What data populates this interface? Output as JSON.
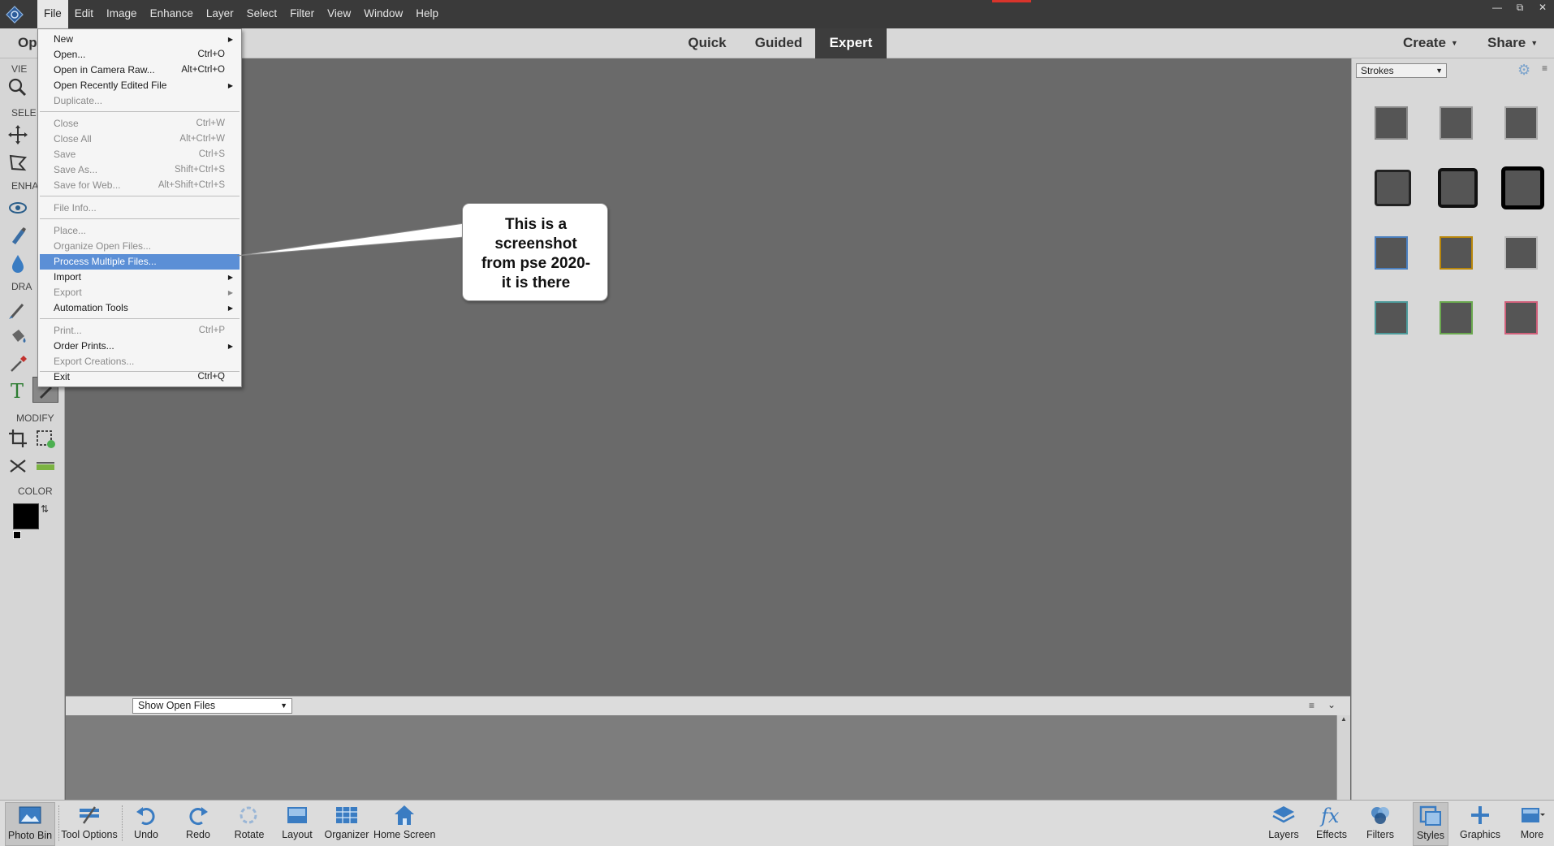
{
  "menubar": {
    "items": [
      "File",
      "Edit",
      "Image",
      "Enhance",
      "Layer",
      "Select",
      "Filter",
      "View",
      "Window",
      "Help"
    ],
    "active": "File"
  },
  "modebar": {
    "open_label": "Op",
    "tabs": [
      "Quick",
      "Guided",
      "Expert"
    ],
    "active_tab": "Expert",
    "create_label": "Create",
    "share_label": "Share"
  },
  "toolbox": {
    "sections": [
      "VIE",
      "SELE",
      "ENHA",
      "DRA"
    ],
    "modify_label": "MODIFY",
    "color_label": "COLOR"
  },
  "file_menu": {
    "items": [
      {
        "label": "New",
        "shortcut": "",
        "submenu": true,
        "enabled": true
      },
      {
        "label": "Open...",
        "shortcut": "Ctrl+O",
        "submenu": false,
        "enabled": true
      },
      {
        "label": "Open in Camera Raw...",
        "shortcut": "Alt+Ctrl+O",
        "submenu": false,
        "enabled": true
      },
      {
        "label": "Open Recently Edited File",
        "shortcut": "",
        "submenu": true,
        "enabled": true
      },
      {
        "label": "Duplicate...",
        "shortcut": "",
        "submenu": false,
        "enabled": false
      },
      {
        "label": "Close",
        "shortcut": "Ctrl+W",
        "submenu": false,
        "enabled": false
      },
      {
        "label": "Close All",
        "shortcut": "Alt+Ctrl+W",
        "submenu": false,
        "enabled": false
      },
      {
        "label": "Save",
        "shortcut": "Ctrl+S",
        "submenu": false,
        "enabled": false
      },
      {
        "label": "Save As...",
        "shortcut": "Shift+Ctrl+S",
        "submenu": false,
        "enabled": false
      },
      {
        "label": "Save for Web...",
        "shortcut": "Alt+Shift+Ctrl+S",
        "submenu": false,
        "enabled": false
      },
      {
        "label": "File Info...",
        "shortcut": "",
        "submenu": false,
        "enabled": false
      },
      {
        "label": "Place...",
        "shortcut": "",
        "submenu": false,
        "enabled": false
      },
      {
        "label": "Organize Open Files...",
        "shortcut": "",
        "submenu": false,
        "enabled": false
      },
      {
        "label": "Process Multiple Files...",
        "shortcut": "",
        "submenu": false,
        "enabled": true,
        "highlighted": true
      },
      {
        "label": "Import",
        "shortcut": "",
        "submenu": true,
        "enabled": true
      },
      {
        "label": "Export",
        "shortcut": "",
        "submenu": true,
        "enabled": false
      },
      {
        "label": "Automation Tools",
        "shortcut": "",
        "submenu": true,
        "enabled": true
      },
      {
        "label": "Print...",
        "shortcut": "Ctrl+P",
        "submenu": false,
        "enabled": false
      },
      {
        "label": "Order Prints...",
        "shortcut": "",
        "submenu": true,
        "enabled": true
      },
      {
        "label": "Export Creations...",
        "shortcut": "",
        "submenu": false,
        "enabled": false
      },
      {
        "label": "Exit",
        "shortcut": "Ctrl+Q",
        "submenu": false,
        "enabled": true
      }
    ]
  },
  "callout": {
    "text": "This is a\nscreenshot\nfrom pse 2020-\nit is there"
  },
  "photo_bin": {
    "selected_option": "Show Open Files"
  },
  "right_panel": {
    "category": "Strokes"
  },
  "bottombar": {
    "left": [
      "Photo Bin",
      "Tool Options",
      "Undo",
      "Redo",
      "Rotate",
      "Layout",
      "Organizer",
      "Home Screen"
    ],
    "right": [
      "Layers",
      "Effects",
      "Filters",
      "Styles",
      "Graphics",
      "More"
    ]
  },
  "colors": {
    "accent_blue": "#5b8fd6",
    "menubar_bg": "#3a3a3a",
    "canvas_bg": "#6a6a6a",
    "foreground_color": "#000000",
    "background_color": "#ffffff"
  }
}
